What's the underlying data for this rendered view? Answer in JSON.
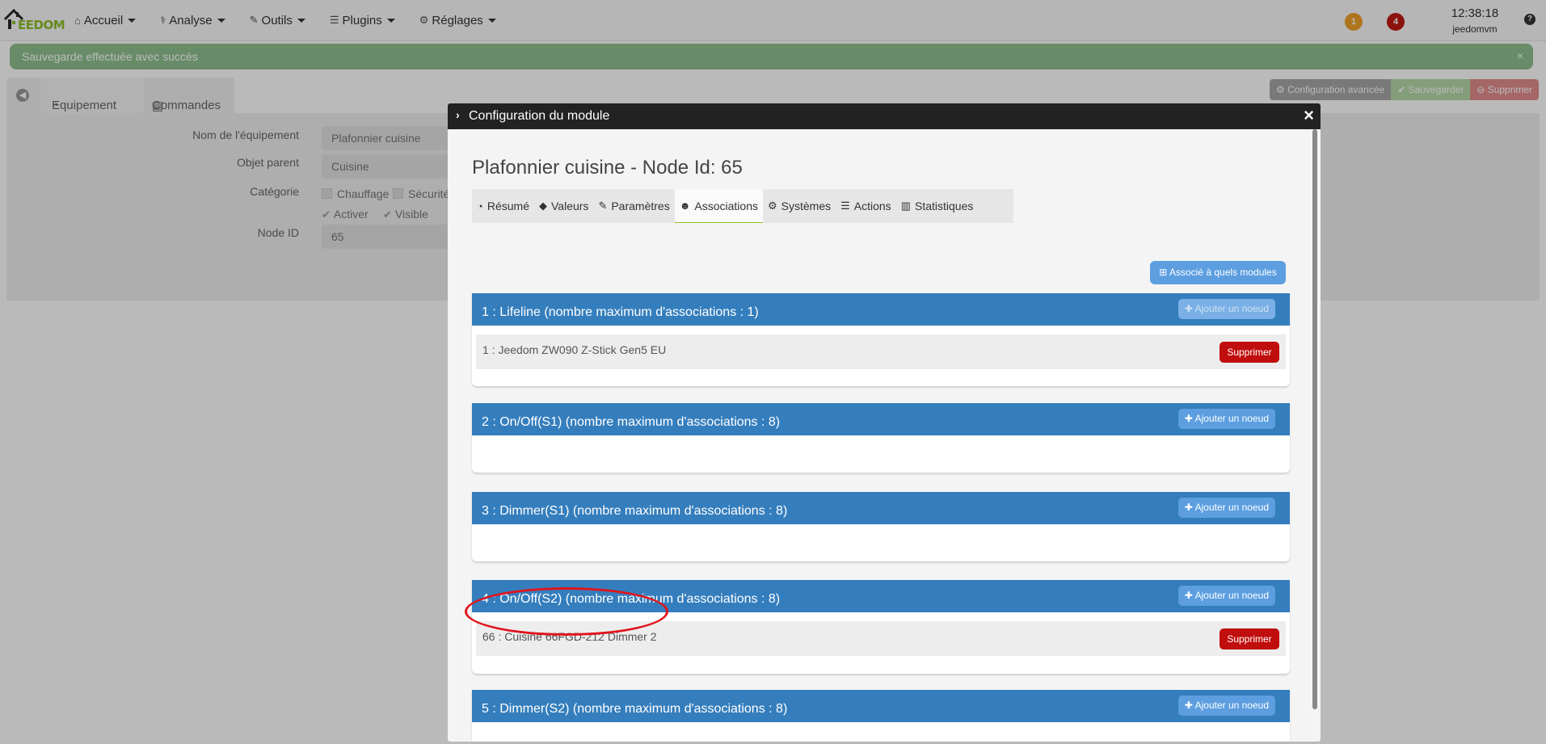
{
  "navbar": {
    "logo_text": "EEDOM",
    "menu": [
      {
        "label": "Accueil",
        "icon": "home-icon"
      },
      {
        "label": "Analyse",
        "icon": "stethoscope-icon"
      },
      {
        "label": "Outils",
        "icon": "wrench-icon"
      },
      {
        "label": "Plugins",
        "icon": "list-icon"
      },
      {
        "label": "Réglages",
        "icon": "gear-icon"
      }
    ],
    "badge_warning": "1",
    "badge_alert": "4",
    "clock": "12:38:18",
    "user": "jeedomvm",
    "help": "?"
  },
  "alert": {
    "message": "Sauvegarde effectuée avec succès",
    "close": "×"
  },
  "background": {
    "tabs": [
      "Equipement",
      "Commandes"
    ],
    "buttons": {
      "advanced": "Configuration avancée",
      "save": "Sauvegarder",
      "delete": "Supprimer"
    },
    "form": {
      "name_label": "Nom de l'équipement",
      "name_value": "Plafonnier cuisine",
      "parent_label": "Objet parent",
      "parent_value": "Cuisine",
      "category_label": "Catégorie",
      "categories": [
        "Chauffage",
        "Sécurité"
      ],
      "activate": "Activer",
      "visible": "Visible",
      "node_label": "Node ID",
      "node_value": "65"
    }
  },
  "modal": {
    "title": "Configuration du module",
    "close": "×",
    "node_title": "Plafonnier cuisine - Node Id: 65",
    "tabs": [
      {
        "label": "Résumé",
        "icon": "dashboard-icon"
      },
      {
        "label": "Valeurs",
        "icon": "tag-icon"
      },
      {
        "label": "Paramètres",
        "icon": "wrench-icon"
      },
      {
        "label": "Associations",
        "icon": "users-icon",
        "active": true
      },
      {
        "label": "Systèmes",
        "icon": "cogs-icon"
      },
      {
        "label": "Actions",
        "icon": "sliders-icon"
      },
      {
        "label": "Statistiques",
        "icon": "bar-chart-icon"
      }
    ],
    "which_modules_button": "Associé à quels modules",
    "add_node_label": "Ajouter un noeud",
    "delete_label": "Supprimer",
    "groups": [
      {
        "title": "1 : Lifeline (nombre maximum d'associations : 1)",
        "associations": [
          "1 : Jeedom ZW090 Z-Stick Gen5 EU"
        ]
      },
      {
        "title": "2 : On/Off(S1) (nombre maximum d'associations : 8)",
        "associations": []
      },
      {
        "title": "3 : Dimmer(S1) (nombre maximum d'associations : 8)",
        "associations": []
      },
      {
        "title": "4 : On/Off(S2) (nombre maximum d'associations : 8)",
        "associations": [
          "66 : Cuisine 66FGD-212 Dimmer 2"
        ]
      },
      {
        "title": "5 : Dimmer(S2) (nombre maximum d'associations : 8)",
        "associations": []
      }
    ]
  },
  "colors": {
    "navbar_bg": "#fafafa",
    "accent_green": "#8cbf26",
    "group_header_blue": "#357ebd",
    "button_blue": "#5c9ee0",
    "delete_red": "#c00d0d",
    "highlight_ellipse": "#e0141c"
  }
}
